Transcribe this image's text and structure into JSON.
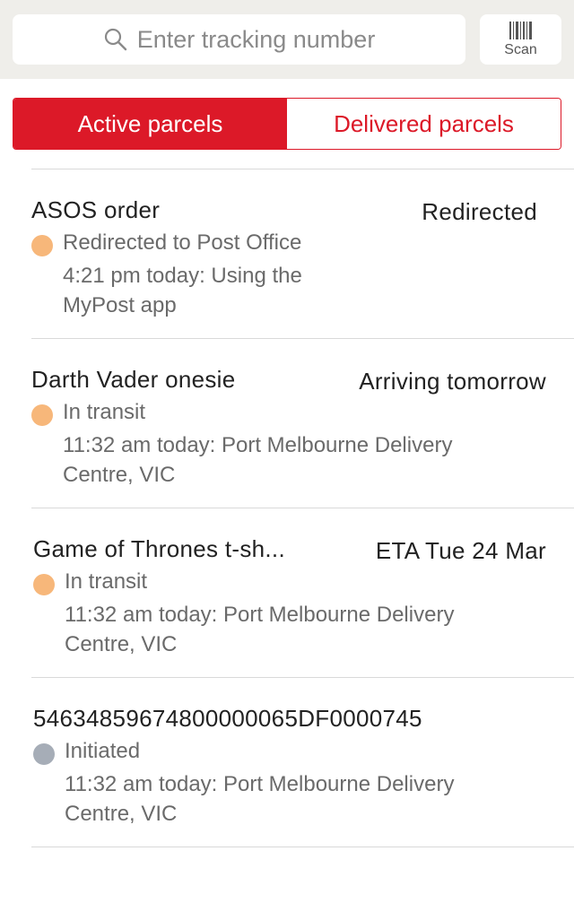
{
  "search": {
    "placeholder": "Enter tracking number",
    "icon": "search-icon"
  },
  "scan": {
    "label": "Scan",
    "icon": "barcode-icon"
  },
  "tabs": [
    {
      "label": "Active parcels",
      "active": true
    },
    {
      "label": "Delivered parcels",
      "active": false
    }
  ],
  "colors": {
    "accent": "#dc1928",
    "transit": "#f7b77a",
    "initiated": "#a6adb7"
  },
  "parcels": [
    {
      "name": "ASOS order",
      "summary": "Redirected",
      "status": "Redirected to Post Office",
      "detail": "4:21 pm today: Using the MyPost app",
      "dot_color": "#f7b77a"
    },
    {
      "name": "Darth Vader onesie",
      "summary": "Arriving tomorrow",
      "status": "In transit",
      "detail": "11:32 am today: Port Melbourne Delivery Centre, VIC",
      "dot_color": "#f7b77a"
    },
    {
      "name": "Game of Thrones t-sh...",
      "summary": "ETA Tue 24 Mar",
      "status": "In transit",
      "detail": "11:32 am today: Port Melbourne Delivery Centre, VIC",
      "dot_color": "#f7b77a"
    },
    {
      "name": "54634859674800000065DF0000745",
      "summary": "",
      "status": "Initiated",
      "detail": "11:32 am today: Port Melbourne Delivery Centre, VIC",
      "dot_color": "#a6adb7"
    }
  ]
}
